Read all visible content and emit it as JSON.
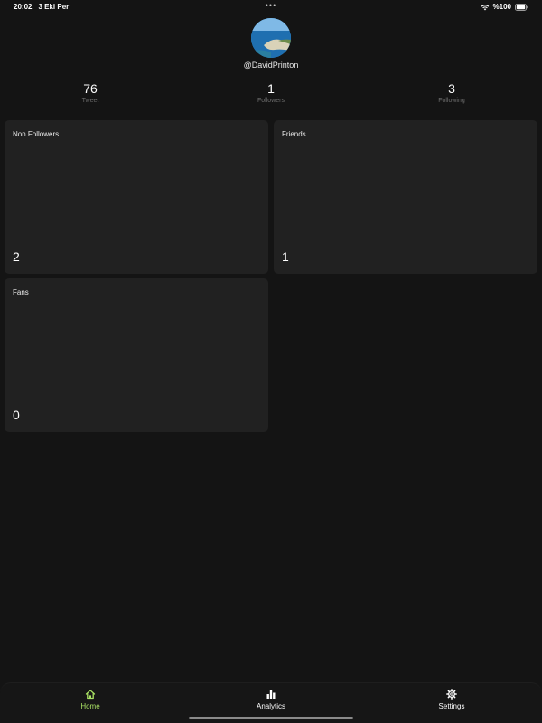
{
  "status_bar": {
    "time": "20:02",
    "date": "3 Eki Per",
    "dots": "•••",
    "battery_text": "%100"
  },
  "profile": {
    "username": "@DavidPrinton"
  },
  "stats": [
    {
      "value": "76",
      "label": "Tweet"
    },
    {
      "value": "1",
      "label": "Followers"
    },
    {
      "value": "3",
      "label": "Following"
    }
  ],
  "cards": [
    {
      "title": "Non Followers",
      "value": "2"
    },
    {
      "title": "Friends",
      "value": "1"
    },
    {
      "title": "Fans",
      "value": "0"
    }
  ],
  "nav": {
    "items": [
      {
        "label": "Home",
        "icon": "home-icon",
        "active": true
      },
      {
        "label": "Analytics",
        "icon": "bar-chart-icon",
        "active": false
      },
      {
        "label": "Settings",
        "icon": "gear-icon",
        "active": false
      }
    ],
    "active_color": "#a8e063"
  }
}
